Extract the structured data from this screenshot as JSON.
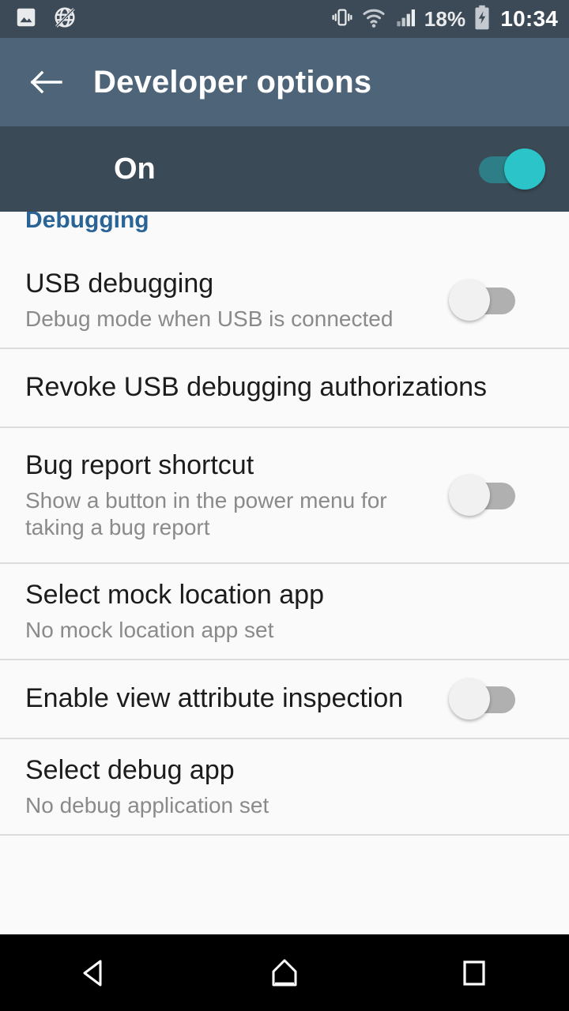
{
  "status_bar": {
    "background": "#3c4a57",
    "left_icons": [
      {
        "name": "screenshot-image-icon",
        "label": "image"
      },
      {
        "name": "no-internet-globe-icon",
        "label": "globe-off"
      }
    ],
    "right_icons": [
      {
        "name": "vibrate-icon",
        "label": "vibrate"
      },
      {
        "name": "wifi-icon",
        "label": "wifi"
      },
      {
        "name": "cellular-signal-icon",
        "label": "signal"
      }
    ],
    "battery_percent": "18%",
    "battery_state": "charging",
    "clock": "10:34"
  },
  "app_bar": {
    "background": "#4e6579",
    "back_icon": "arrow-left-icon",
    "title": "Developer options"
  },
  "master_switch": {
    "background": "#3b4a57",
    "label": "On",
    "state": "on",
    "accent": "#2ac4c9"
  },
  "sections": [
    {
      "header": "Debugging",
      "header_color": "#2a6496",
      "rows": [
        {
          "title": "USB debugging",
          "subtitle": "Debug mode when USB is connected",
          "control": "switch",
          "state": "off",
          "lines": 2
        },
        {
          "title": "Revoke USB debugging authorizations",
          "subtitle": "",
          "control": "none",
          "state": "",
          "lines": 1
        },
        {
          "title": "Bug report shortcut",
          "subtitle": "Show a button in the power menu for taking a bug report",
          "control": "switch",
          "state": "off",
          "lines": 3
        },
        {
          "title": "Select mock location app",
          "subtitle": "No mock location app set",
          "control": "none",
          "state": "",
          "lines": 2
        },
        {
          "title": "Enable view attribute inspection",
          "subtitle": "",
          "control": "switch",
          "state": "off",
          "lines": 1
        },
        {
          "title": "Select debug app",
          "subtitle": "No debug application set",
          "control": "none",
          "state": "",
          "lines": 2
        }
      ]
    }
  ],
  "nav_bar": {
    "background": "#000000",
    "buttons": [
      {
        "name": "back-nav-button",
        "label": "Back"
      },
      {
        "name": "home-nav-button",
        "label": "Home"
      },
      {
        "name": "recents-nav-button",
        "label": "Recents"
      }
    ]
  }
}
